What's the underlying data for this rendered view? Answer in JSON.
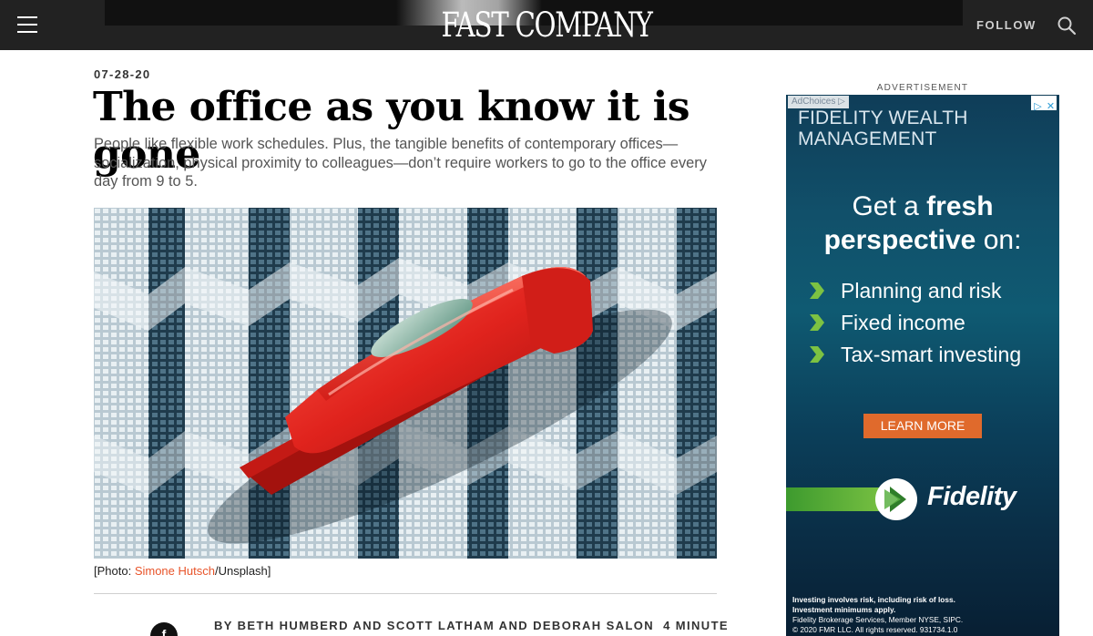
{
  "nav": {
    "logo": "FAST COMPANY",
    "follow_label": "FOLLOW",
    "menu_icon": "hamburger-menu-icon",
    "search_icon": "search-icon",
    "background": "#222222"
  },
  "article": {
    "date": "07-28-20",
    "headline": "The office as you know it is gone",
    "dek": "People like flexible work schedules. Plus, the tangible benefits of contemporary offices—socialization, physical proximity to colleagues—don’t require workers to go to the office every day from 9 to 5.",
    "image_alt": "Red stapler against office buildings",
    "caption": {
      "prefix": "[Photo: ",
      "credit_name": "Simone Hutsch",
      "suffix": "/Unsplash]"
    },
    "share_icon": "facebook-icon",
    "share_letter": "f",
    "byline": "BY BETH HUMBERD AND SCOTT LATHAM AND DEBORAH SALON",
    "read_time": "4 MINUTE",
    "link_color": "#e8542a"
  },
  "ad": {
    "label": "ADVERTISEMENT",
    "adchoices": "AdChoices",
    "brand_top_line1": "FIDELITY WEALTH",
    "brand_top_line2": "MANAGEMENT",
    "tagline_pre": "Get a ",
    "tagline_bold1": "fresh",
    "tagline_bold2": "perspective",
    "tagline_post": " on:",
    "bullets": [
      "Planning and risk",
      "Fixed income",
      "Tax-smart investing"
    ],
    "cta": "LEARN MORE",
    "brand": "Fidelity",
    "disclaimer": [
      "Investing involves risk, including risk of loss.",
      "Investment minimums apply.",
      "Fidelity Brokerage Services, Member NYSE, SIPC.",
      "© 2020 FMR LLC. All rights reserved. 931734.1.0"
    ],
    "cta_color": "#e06a2c",
    "chevron_color": "#7cc242"
  }
}
